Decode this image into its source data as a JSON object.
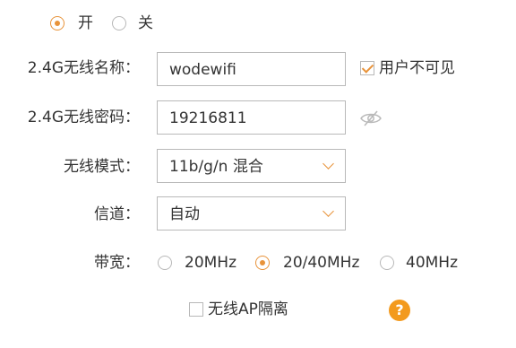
{
  "wifi_switch": {
    "on_label": "开",
    "off_label": "关",
    "selected": "on"
  },
  "ssid": {
    "label": "2.4G无线名称：",
    "value": "wodewifi",
    "hide_label": "用户不可见",
    "hide_checked": true
  },
  "password": {
    "label": "2.4G无线密码：",
    "value": "19216811",
    "visibility_icon": "eye-hidden-icon"
  },
  "mode": {
    "label": "无线模式：",
    "value": "11b/g/n 混合"
  },
  "channel": {
    "label": "信道：",
    "value": "自动"
  },
  "bandwidth": {
    "label": "带宽：",
    "options": [
      "20MHz",
      "20/40MHz",
      "40MHz"
    ],
    "selected": "20/40MHz"
  },
  "ap_isolation": {
    "label": "无线AP隔离",
    "checked": false
  },
  "help": {
    "glyph": "?"
  },
  "colors": {
    "accent": "#e8933a",
    "help_bg": "#f39a1e",
    "border": "#b9b9b9",
    "text": "#333333"
  }
}
